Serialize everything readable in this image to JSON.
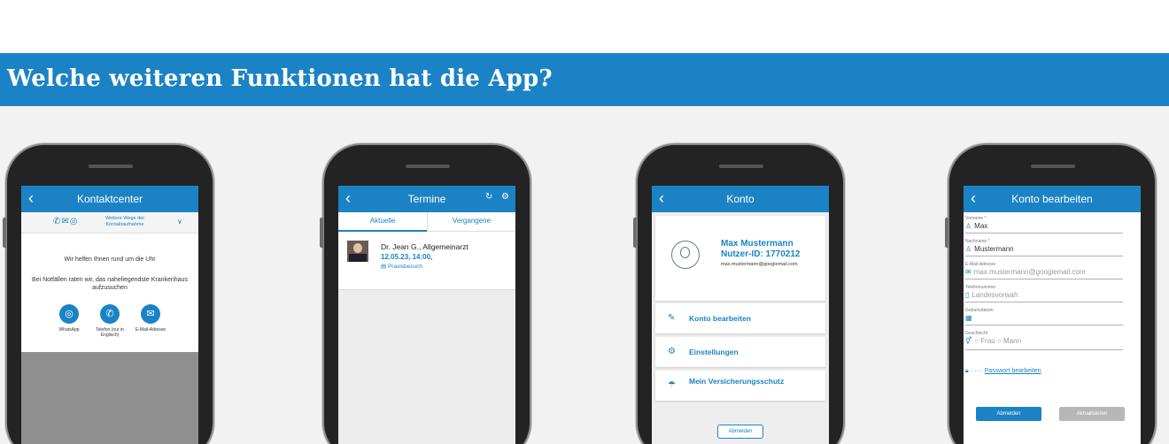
{
  "banner": {
    "title": "Welche weiteren Funktionen hat die App?"
  },
  "colors": {
    "accent": "#1b83c5",
    "background": "#f2f2f2"
  },
  "screens": {
    "kontaktcenter": {
      "title": "Kontaktcenter",
      "more_ways": "Weitere Wege der Kontaktaufnahme",
      "help_text": "Wir helfen Ihnen rund um die Uhr",
      "emergency_text": "Bei Notfällen raten wir, das naheliegendste Krankenhaus aufzusuchen",
      "contacts": [
        {
          "icon": "whatsapp-icon",
          "label": "WhatsApp"
        },
        {
          "icon": "phone-icon",
          "label": "Telefon (nur in Englisch)"
        },
        {
          "icon": "mail-icon",
          "label": "E-Mail-Adresse"
        }
      ]
    },
    "termine": {
      "title": "Termine",
      "tabs": [
        "Aktuelle",
        "Vergangene"
      ],
      "appointment": {
        "doctor": "Dr. Jean G., Allgemeinarzt",
        "datetime": "12.05.23, 14:00,",
        "type": "Praxisbesuch"
      }
    },
    "konto": {
      "title": "Konto",
      "name": "Max Mustermann",
      "user_id": "Nutzer-ID: 1770212",
      "email": "max.mustermann@googlemail.com",
      "menu": [
        {
          "icon": "edit-icon",
          "label": "Konto bearbeiten"
        },
        {
          "icon": "settings-icon",
          "label": "Einstellungen"
        },
        {
          "icon": "umbrella-icon",
          "label": "Mein Versicherungsschutz"
        }
      ],
      "logout": "Abmelden"
    },
    "konto_bearbeiten": {
      "title": "Konto bearbeiten",
      "fields": [
        {
          "label": "Vorname *",
          "value": "Max",
          "icon": "person-icon"
        },
        {
          "label": "Nachname *",
          "value": "Mustermann",
          "icon": "person-icon"
        },
        {
          "label": "E-Mail-Adresse",
          "value": "max.mustermann@googlemail.com",
          "icon": "mail-icon"
        },
        {
          "label": "Telefonnummer",
          "value": "Landesvorwah",
          "icon": "phone-icon"
        },
        {
          "label": "Geburtsdatum",
          "value": "",
          "icon": "calendar-icon"
        },
        {
          "label": "Geschlecht",
          "value": "○ Frau    ○ Mann",
          "icon": "gender-icon"
        }
      ],
      "password_mask": "······",
      "password_link": "Passwort bearbeiten",
      "logout": "Abmelden",
      "update": "Aktualisieren"
    }
  }
}
